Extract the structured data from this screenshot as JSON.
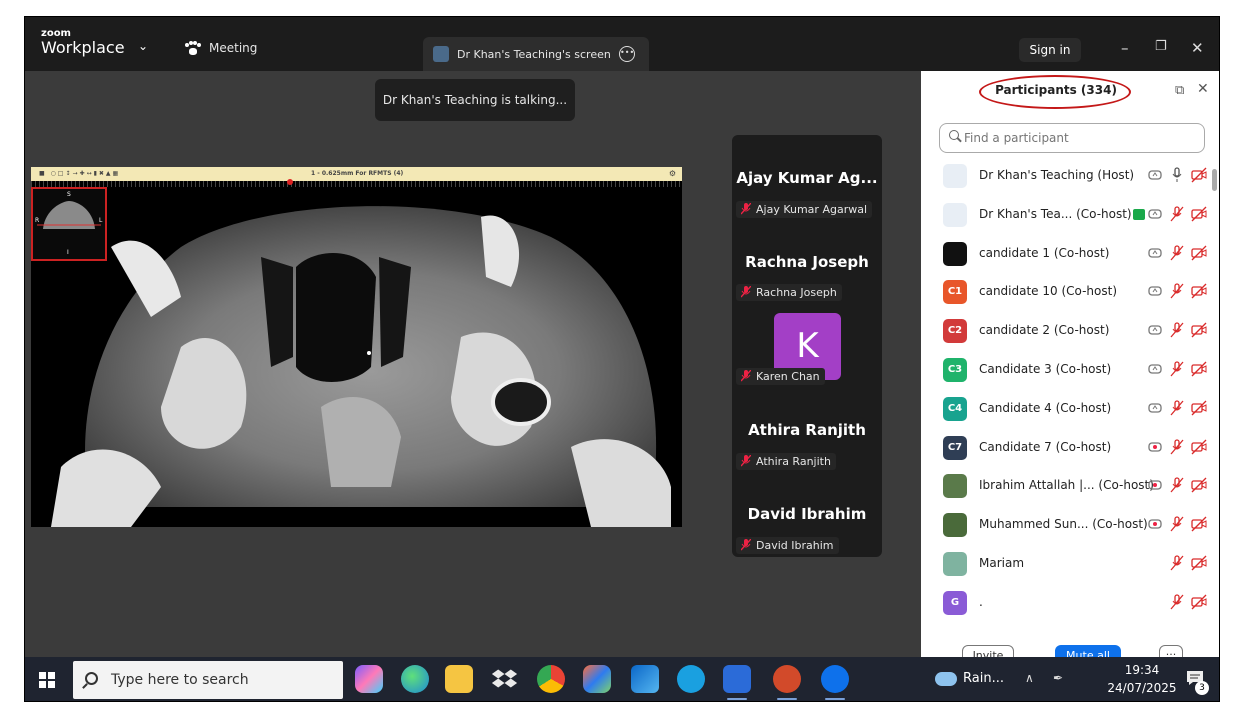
{
  "titlebar": {
    "brand_small": "zoom",
    "brand_big": "Workplace",
    "meeting_tab": "Meeting",
    "share_tab": "Dr Khan's Teaching's screen",
    "sign_in": "Sign in"
  },
  "stage": {
    "talking_notice": "Dr Khan's Teaching is talking...",
    "viewer_status": "1 - 0.625mm For RFMTS (4)",
    "scout_labels": {
      "top": "S",
      "left": "R",
      "right": "L",
      "bottom": "I"
    }
  },
  "speakers": [
    {
      "display": "Ajay Kumar Ag...",
      "tag": "Ajay Kumar Agarwal"
    },
    {
      "display": "Rachna Joseph",
      "tag": "Rachna Joseph"
    },
    {
      "display": "",
      "tag": "Karen Chan",
      "avatar_letter": "K",
      "avatar_color": "#a33fc6"
    },
    {
      "display": "Athira Ranjith",
      "tag": "Athira Ranjith"
    },
    {
      "display": "David Ibrahim",
      "tag": "David Ibrahim"
    }
  ],
  "participants": {
    "title": "Participants (334)",
    "search_placeholder": "Find a participant",
    "rows": [
      {
        "name": "Dr Khan's Teaching (Host)",
        "avatar": "",
        "avatar_color": "#e8eef5",
        "video": false,
        "mic_on": true,
        "share": true
      },
      {
        "name": "Dr Khan's Tea... (Co-host)",
        "avatar": "",
        "avatar_color": "#e8eef5",
        "video": false,
        "mic_on": false,
        "share": true,
        "badge": "green"
      },
      {
        "name": "candidate 1 (Co-host)",
        "avatar": "",
        "avatar_color": "#111111",
        "video": false,
        "mic_on": false,
        "share": true
      },
      {
        "name": "candidate 10 (Co-host)",
        "avatar": "C1",
        "avatar_color": "#e8562a",
        "video": false,
        "mic_on": false,
        "share": true
      },
      {
        "name": "candidate 2 (Co-host)",
        "avatar": "C2",
        "avatar_color": "#d23a3a",
        "video": false,
        "mic_on": false,
        "share": true
      },
      {
        "name": "Candidate 3 (Co-host)",
        "avatar": "C3",
        "avatar_color": "#1fb36b",
        "video": false,
        "mic_on": false,
        "share": true
      },
      {
        "name": "Candidate 4 (Co-host)",
        "avatar": "C4",
        "avatar_color": "#18a38f",
        "video": false,
        "mic_on": false,
        "share": true
      },
      {
        "name": "Candidate 7 (Co-host)",
        "avatar": "C7",
        "avatar_color": "#2f3e55",
        "video": false,
        "mic_on": false,
        "share": true,
        "share_red": true
      },
      {
        "name": "Ibrahim Attallah |... (Co-host)",
        "avatar": "",
        "avatar_color": "#5a7a4a",
        "video": false,
        "mic_on": false,
        "share": true,
        "share_red": true
      },
      {
        "name": "Muhammed Sun... (Co-host)",
        "avatar": "",
        "avatar_color": "#4a6a3a",
        "video": false,
        "mic_on": false,
        "share": true,
        "share_red": true
      },
      {
        "name": "Mariam",
        "avatar": "",
        "avatar_color": "#7fb3a0",
        "video": false,
        "mic_on": false,
        "share": false
      },
      {
        "name": ".",
        "avatar": "G",
        "avatar_color": "#8a5bd6",
        "video": false,
        "mic_on": false,
        "share": false
      }
    ],
    "invite_label": "Invite",
    "mute_all_label": "Mute all",
    "more_label": "···"
  },
  "taskbar": {
    "search_text": "Type here to search",
    "weather_text": "Rain...",
    "time": "19:34",
    "date": "24/07/2025",
    "notification_count": "3"
  },
  "colors": {
    "accent_blue": "#0e71eb",
    "muted_red": "#d92b2b",
    "highlight_oval": "#c41818"
  }
}
